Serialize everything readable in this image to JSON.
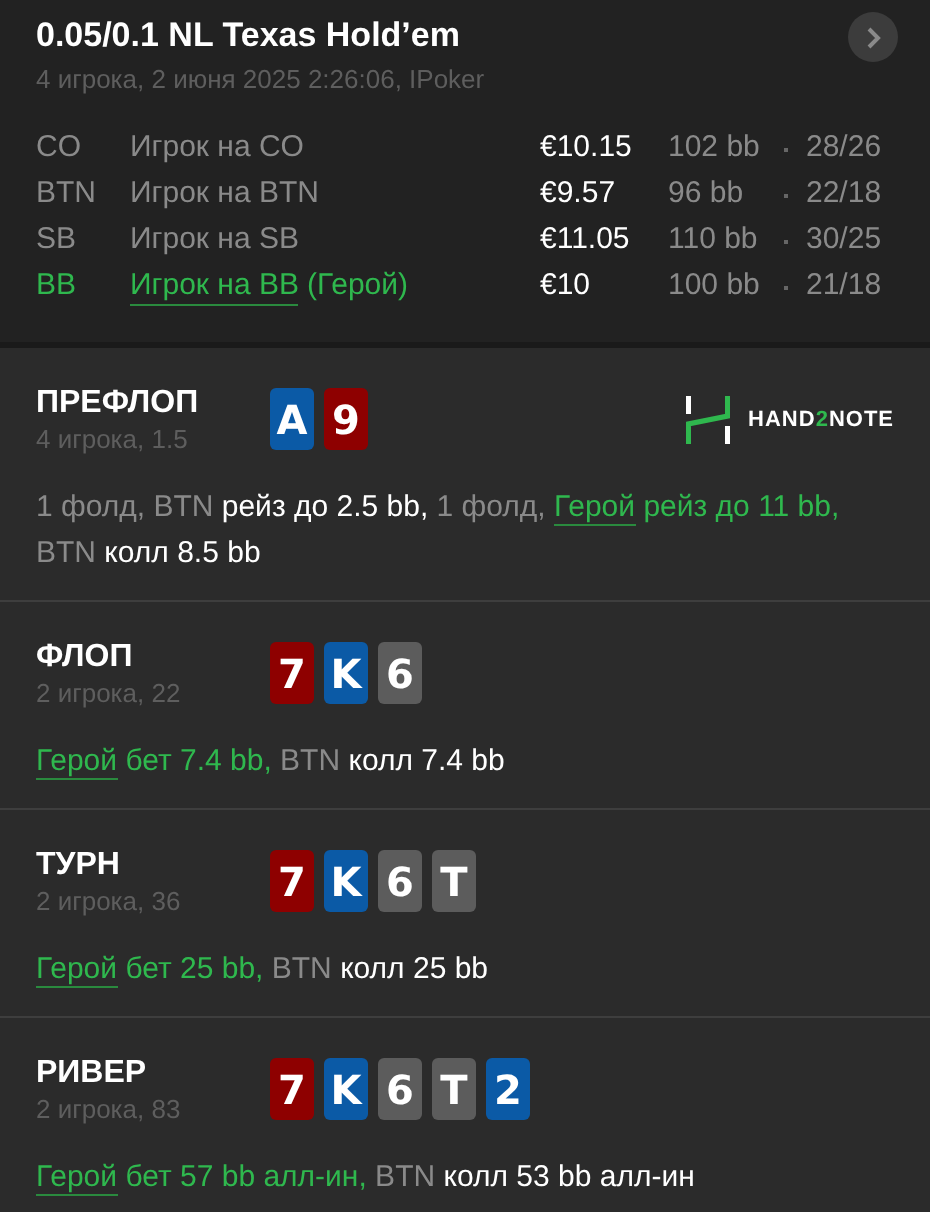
{
  "header": {
    "title": "0.05/0.1 NL Texas Hold’em",
    "subtitle": "4 игрока, 2 июня 2025 2:26:06, IPoker",
    "players": [
      {
        "position": "CO",
        "name": "Игрок на CO",
        "hero": false,
        "stack": "€10.15",
        "bb": "102 bb",
        "stats": "28/26"
      },
      {
        "position": "BTN",
        "name": "Игрок на BTN",
        "hero": false,
        "stack": "€9.57",
        "bb": "96 bb",
        "stats": "22/18"
      },
      {
        "position": "SB",
        "name": "Игрок на SB",
        "hero": false,
        "stack": "€11.05",
        "bb": "110 bb",
        "stats": "30/25"
      },
      {
        "position": "BB",
        "name": "Игрок на BB",
        "hero": true,
        "hero_tag": "(Герой)",
        "stack": "€10",
        "bb": "100 bb",
        "stats": "21/18"
      }
    ]
  },
  "streets": [
    {
      "name": "ПРЕФЛОП",
      "info": "4 игрока, 1.5",
      "logo": {
        "before": "HAND",
        "accent": "2",
        "after": "NOTE"
      },
      "cards": [
        {
          "rank": "A",
          "color": "#0b5aa6"
        },
        {
          "rank": "9",
          "color": "#8e0000"
        }
      ],
      "actions": [
        {
          "kind": "muted",
          "text": "1 фолд, BTN "
        },
        {
          "kind": "action",
          "text": "рейз до 2.5 bb,"
        },
        {
          "kind": "muted",
          "text": " 1 фолд, "
        },
        {
          "kind": "hero",
          "text": "Герой"
        },
        {
          "kind": "hero_action",
          "text": " рейз до 11 bb,"
        },
        {
          "kind": "muted",
          "text": " BTN "
        },
        {
          "kind": "action",
          "text": "колл 8.5 bb"
        }
      ]
    },
    {
      "name": "ФЛОП",
      "info": "2 игрока, 22",
      "cards": [
        {
          "rank": "7",
          "color": "#8e0000"
        },
        {
          "rank": "K",
          "color": "#0b5aa6"
        },
        {
          "rank": "6",
          "color": "#5c5c5c"
        }
      ],
      "actions": [
        {
          "kind": "hero",
          "text": "Герой"
        },
        {
          "kind": "hero_action",
          "text": " бет 7.4 bb,"
        },
        {
          "kind": "muted",
          "text": " BTN "
        },
        {
          "kind": "action",
          "text": "колл 7.4 bb"
        }
      ]
    },
    {
      "name": "ТУРН",
      "info": "2 игрока, 36",
      "cards": [
        {
          "rank": "7",
          "color": "#8e0000"
        },
        {
          "rank": "K",
          "color": "#0b5aa6"
        },
        {
          "rank": "6",
          "color": "#5c5c5c"
        },
        {
          "rank": "T",
          "color": "#5c5c5c"
        }
      ],
      "actions": [
        {
          "kind": "hero",
          "text": "Герой"
        },
        {
          "kind": "hero_action",
          "text": " бет 25 bb,"
        },
        {
          "kind": "muted",
          "text": " BTN "
        },
        {
          "kind": "action",
          "text": "колл 25 bb"
        }
      ]
    },
    {
      "name": "РИВЕР",
      "info": "2 игрока, 83",
      "cards": [
        {
          "rank": "7",
          "color": "#8e0000"
        },
        {
          "rank": "K",
          "color": "#0b5aa6"
        },
        {
          "rank": "6",
          "color": "#5c5c5c"
        },
        {
          "rank": "T",
          "color": "#5c5c5c"
        },
        {
          "rank": "2",
          "color": "#0b5aa6"
        }
      ],
      "actions": [
        {
          "kind": "hero",
          "text": "Герой"
        },
        {
          "kind": "hero_action",
          "text": " бет 57 bb алл-ин,"
        },
        {
          "kind": "muted",
          "text": " BTN "
        },
        {
          "kind": "action",
          "text": "колл 53 bb алл-ин"
        }
      ]
    }
  ]
}
